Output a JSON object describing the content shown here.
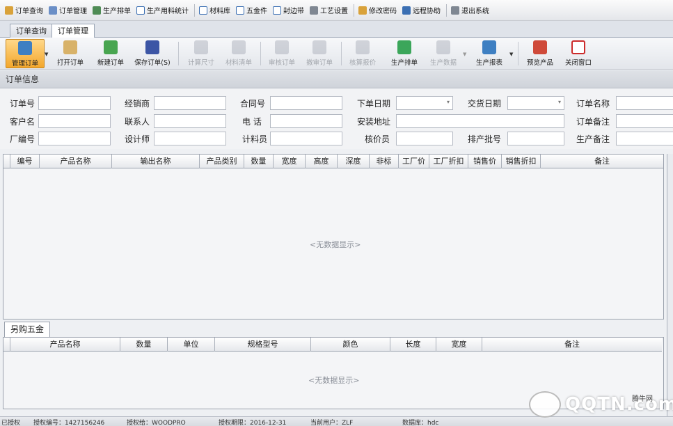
{
  "menubar": {
    "items": [
      {
        "label": "订单查询",
        "icon": "order-query-icon",
        "color": "#d9a23a"
      },
      {
        "label": "订单管理",
        "icon": "order-manage-icon",
        "color": "#6b8fc7"
      },
      {
        "label": "生产排单",
        "icon": "production-schedule-icon",
        "color": "#4f8c55"
      },
      {
        "label": "生产用料统计",
        "icon": "material-stats-icon",
        "color": "#3b6fb3"
      },
      {
        "label": "材料库",
        "icon": "material-library-icon",
        "color": "#3b6fb3"
      },
      {
        "label": "五金件",
        "icon": "hardware-icon",
        "color": "#3b6fb3"
      },
      {
        "label": "封边带",
        "icon": "edge-band-icon",
        "color": "#3b6fb3"
      },
      {
        "label": "工艺设置",
        "icon": "process-settings-icon",
        "color": "#7f8792"
      },
      {
        "label": "修改密码",
        "icon": "key-icon",
        "color": "#d9a23a"
      },
      {
        "label": "远程协助",
        "icon": "remote-assist-icon",
        "color": "#3b6fb3"
      },
      {
        "label": "退出系统",
        "icon": "exit-icon",
        "color": "#7f8792"
      }
    ]
  },
  "tabs": [
    {
      "label": "订单查询"
    },
    {
      "label": "订单管理"
    }
  ],
  "toolbar": {
    "buttons": [
      {
        "label": "管理订单",
        "icon": "manage-order-icon",
        "color": "#3e7fc2"
      },
      {
        "label": "打开订单",
        "icon": "open-order-icon",
        "color": "#d8b269"
      },
      {
        "label": "新建订单",
        "icon": "new-order-icon",
        "color": "#48a550"
      },
      {
        "label": "保存订单(S)",
        "icon": "save-icon",
        "color": "#3c55a5"
      },
      {
        "label": "计算尺寸",
        "icon": "calc-size-icon",
        "color": "#8b93a0"
      },
      {
        "label": "材料清单",
        "icon": "material-list-icon",
        "color": "#8b93a0"
      },
      {
        "label": "审核订单",
        "icon": "audit-order-icon",
        "color": "#8b93a0"
      },
      {
        "label": "撤审订单",
        "icon": "unaudit-order-icon",
        "color": "#8b93a0"
      },
      {
        "label": "核算报价",
        "icon": "quote-icon",
        "color": "#8b93a0"
      },
      {
        "label": "生产排单",
        "icon": "schedule-icon",
        "color": "#3ba65a"
      },
      {
        "label": "生产数据",
        "icon": "production-data-icon",
        "color": "#8b93a0"
      },
      {
        "label": "生产报表",
        "icon": "report-icon",
        "color": "#3e7fc2"
      },
      {
        "label": "预览产品",
        "icon": "preview-icon",
        "color": "#cf4a3a"
      },
      {
        "label": "关闭窗口",
        "icon": "close-window-icon",
        "color": "#cc2b2b"
      }
    ]
  },
  "section_title": "订单信息",
  "form": {
    "order_no": "订单号",
    "dealer": "经销商",
    "contract_no": "合同号",
    "order_date": "下单日期",
    "delivery_date": "交货日期",
    "order_name": "订单名称",
    "customer_name": "客户名",
    "contact": "联系人",
    "phone": "电  话",
    "install_address": "安装地址",
    "order_remark": "订单备注",
    "factory_no": "厂编号",
    "designer": "设计师",
    "counter": "计料员",
    "pricer": "核价员",
    "batch_no": "排产批号",
    "production_remark": "生产备注"
  },
  "grid": {
    "columns": [
      "编号",
      "产品名称",
      "输出名称",
      "产品类别",
      "数量",
      "宽度",
      "高度",
      "深度",
      "非标",
      "工厂价",
      "工厂折扣",
      "销售价",
      "销售折扣",
      "备注"
    ],
    "no_data": "<无数据显示>"
  },
  "hardware_tab": "另购五金",
  "grid2": {
    "columns": [
      "产品名称",
      "数量",
      "单位",
      "规格型号",
      "颜色",
      "长度",
      "宽度",
      "备注"
    ],
    "no_data": "<无数据显示>"
  },
  "status": {
    "authorized": "已授权",
    "license_no": "授权编号：1427156246",
    "licensee": "授权给：WOODPRO",
    "expiry": "授权期限：2016-12-31",
    "current_user": "当前用户：ZLF",
    "database": "数据库：hdc"
  },
  "watermark": {
    "brand": "QQTN.com",
    "site": "腾牛网"
  }
}
